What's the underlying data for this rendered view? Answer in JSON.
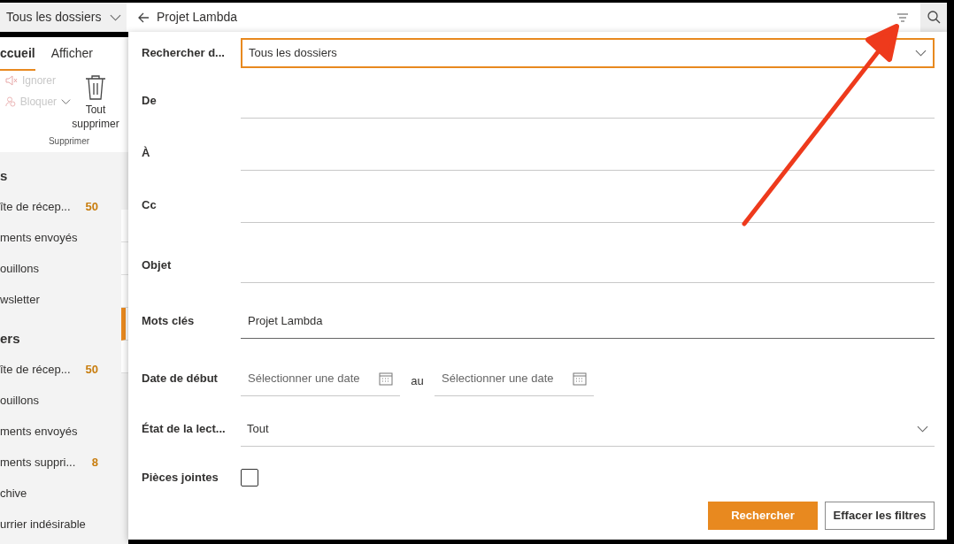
{
  "scope_dropdown": {
    "value": "Tous les dossiers"
  },
  "search_box": {
    "value": "Projet Lambda"
  },
  "ribbon": {
    "tabs": [
      {
        "label": "ccueil",
        "selected": true
      },
      {
        "label": "Afficher",
        "selected": false
      }
    ],
    "commands": [
      {
        "label": "Ignorer",
        "disabled": true
      },
      {
        "label": "Bloquer",
        "disabled": true
      }
    ],
    "delete_all": "Tout supprimer",
    "group_label": "Supprimer"
  },
  "sidebar": {
    "sections": [
      {
        "heading": "s",
        "items": [
          {
            "label": "îte de récep...",
            "count": "50"
          },
          {
            "label": "ments envoyés"
          },
          {
            "label": "ouillons"
          },
          {
            "label": "wsletter"
          }
        ]
      },
      {
        "heading": "ers",
        "items": [
          {
            "label": "îte de récep...",
            "count": "50"
          },
          {
            "label": "ouillons"
          },
          {
            "label": "ments envoyés"
          },
          {
            "label": "ments suppri...",
            "count": "8"
          },
          {
            "label": "chive"
          },
          {
            "label": "urrier indésirable"
          }
        ]
      }
    ]
  },
  "message_list": [
    {
      "selected": false
    },
    {
      "selected": false
    },
    {
      "selected": false
    },
    {
      "selected": true
    },
    {
      "selected": false
    }
  ],
  "search_form": {
    "rows": [
      {
        "kind": "dropdown",
        "label": "Rechercher d...",
        "value": "Tous les dossiers",
        "focused": true
      },
      {
        "kind": "text",
        "label": "De"
      },
      {
        "kind": "text",
        "label": "À"
      },
      {
        "kind": "text",
        "label": "Cc"
      },
      {
        "kind": "text",
        "label": "Objet"
      },
      {
        "kind": "text",
        "label": "Mots clés",
        "value": "Projet Lambda"
      },
      {
        "kind": "date_range",
        "label": "Date de début",
        "from_placeholder": "Sélectionner une date",
        "separator": "au",
        "to_placeholder": "Sélectionner une date"
      },
      {
        "kind": "dropdown",
        "label": "État de la lect...",
        "value": "Tout",
        "focused": false
      },
      {
        "kind": "checkbox",
        "label": "Pièces jointes",
        "checked": false
      }
    ],
    "buttons": [
      {
        "label": "Rechercher",
        "primary": true
      },
      {
        "label": "Effacer les filtres",
        "primary": false
      }
    ]
  }
}
